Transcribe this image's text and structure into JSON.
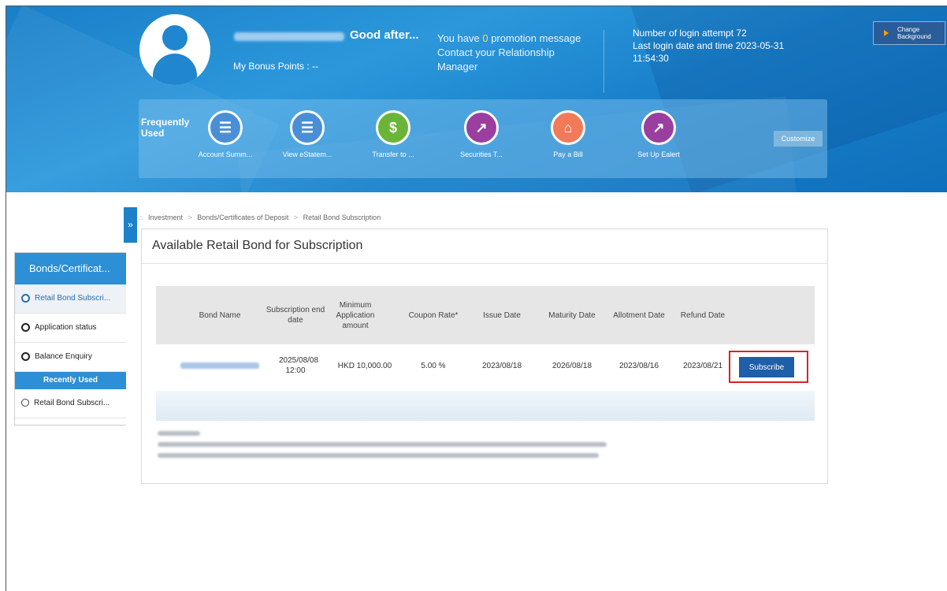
{
  "header": {
    "greeting": "Good after...",
    "bonus_points": "My Bonus Points : --",
    "promotion": {
      "prefix": "You have ",
      "count": "0",
      "suffix": " promotion message"
    },
    "contact": "Contact your Relationship Manager",
    "login_attempts": "Number of login attempt 72",
    "last_login": "Last login date and time 2023-05-31 11:54:30",
    "change_background": "Change Background",
    "frequently_used_label": "Frequently Used",
    "customize_label": "Customize",
    "quick_links": [
      {
        "label": "Account Summ...",
        "icon": "account-summary-icon",
        "color": "#4a8fd6"
      },
      {
        "label": "View eStatem...",
        "icon": "estatement-icon",
        "color": "#4a8fd6"
      },
      {
        "label": "Transfer to ...",
        "icon": "transfer-icon",
        "color": "#6ab537"
      },
      {
        "label": "Securities T...",
        "icon": "securities-chart-icon",
        "color": "#9a3fa0"
      },
      {
        "label": "Pay a Bill",
        "icon": "pay-bill-icon",
        "color": "#f07a5a"
      },
      {
        "label": "Set Up Ealert",
        "icon": "ealert-chart-icon",
        "color": "#9a3fa0"
      }
    ]
  },
  "sidebar": {
    "title": "Bonds/Certificat...",
    "items": [
      {
        "label": "Retail Bond Subscri..."
      },
      {
        "label": "Application status"
      },
      {
        "label": "Balance Enquiry"
      }
    ],
    "recent_title": "Recently Used",
    "recent_items": [
      {
        "label": "Retail Bond Subscri..."
      }
    ]
  },
  "breadcrumb": {
    "items": [
      "Investment",
      "Bonds/Certificates of Deposit",
      "Retail Bond Subscription"
    ],
    "separator": ">"
  },
  "main": {
    "title": "Available Retail Bond for Subscription",
    "columns": [
      "Bond Name",
      "Subscription end date",
      "Minimum Application amount",
      "Coupon Rate*",
      "Issue Date",
      "Maturity Date",
      "Allotment Date",
      "Refund Date"
    ],
    "row": {
      "subscription_end": "2025/08/08 12:00",
      "min_amount": "HKD 10,000.00",
      "coupon_rate": "5.00 %",
      "issue_date": "2023/08/18",
      "maturity_date": "2026/08/18",
      "allotment_date": "2023/08/16",
      "refund_date": "2023/08/21",
      "action": "Subscribe"
    }
  },
  "colors": {
    "accent": "#1f5ea8",
    "highlight": "#d8232a",
    "sidebar": "#2d8fd5"
  }
}
